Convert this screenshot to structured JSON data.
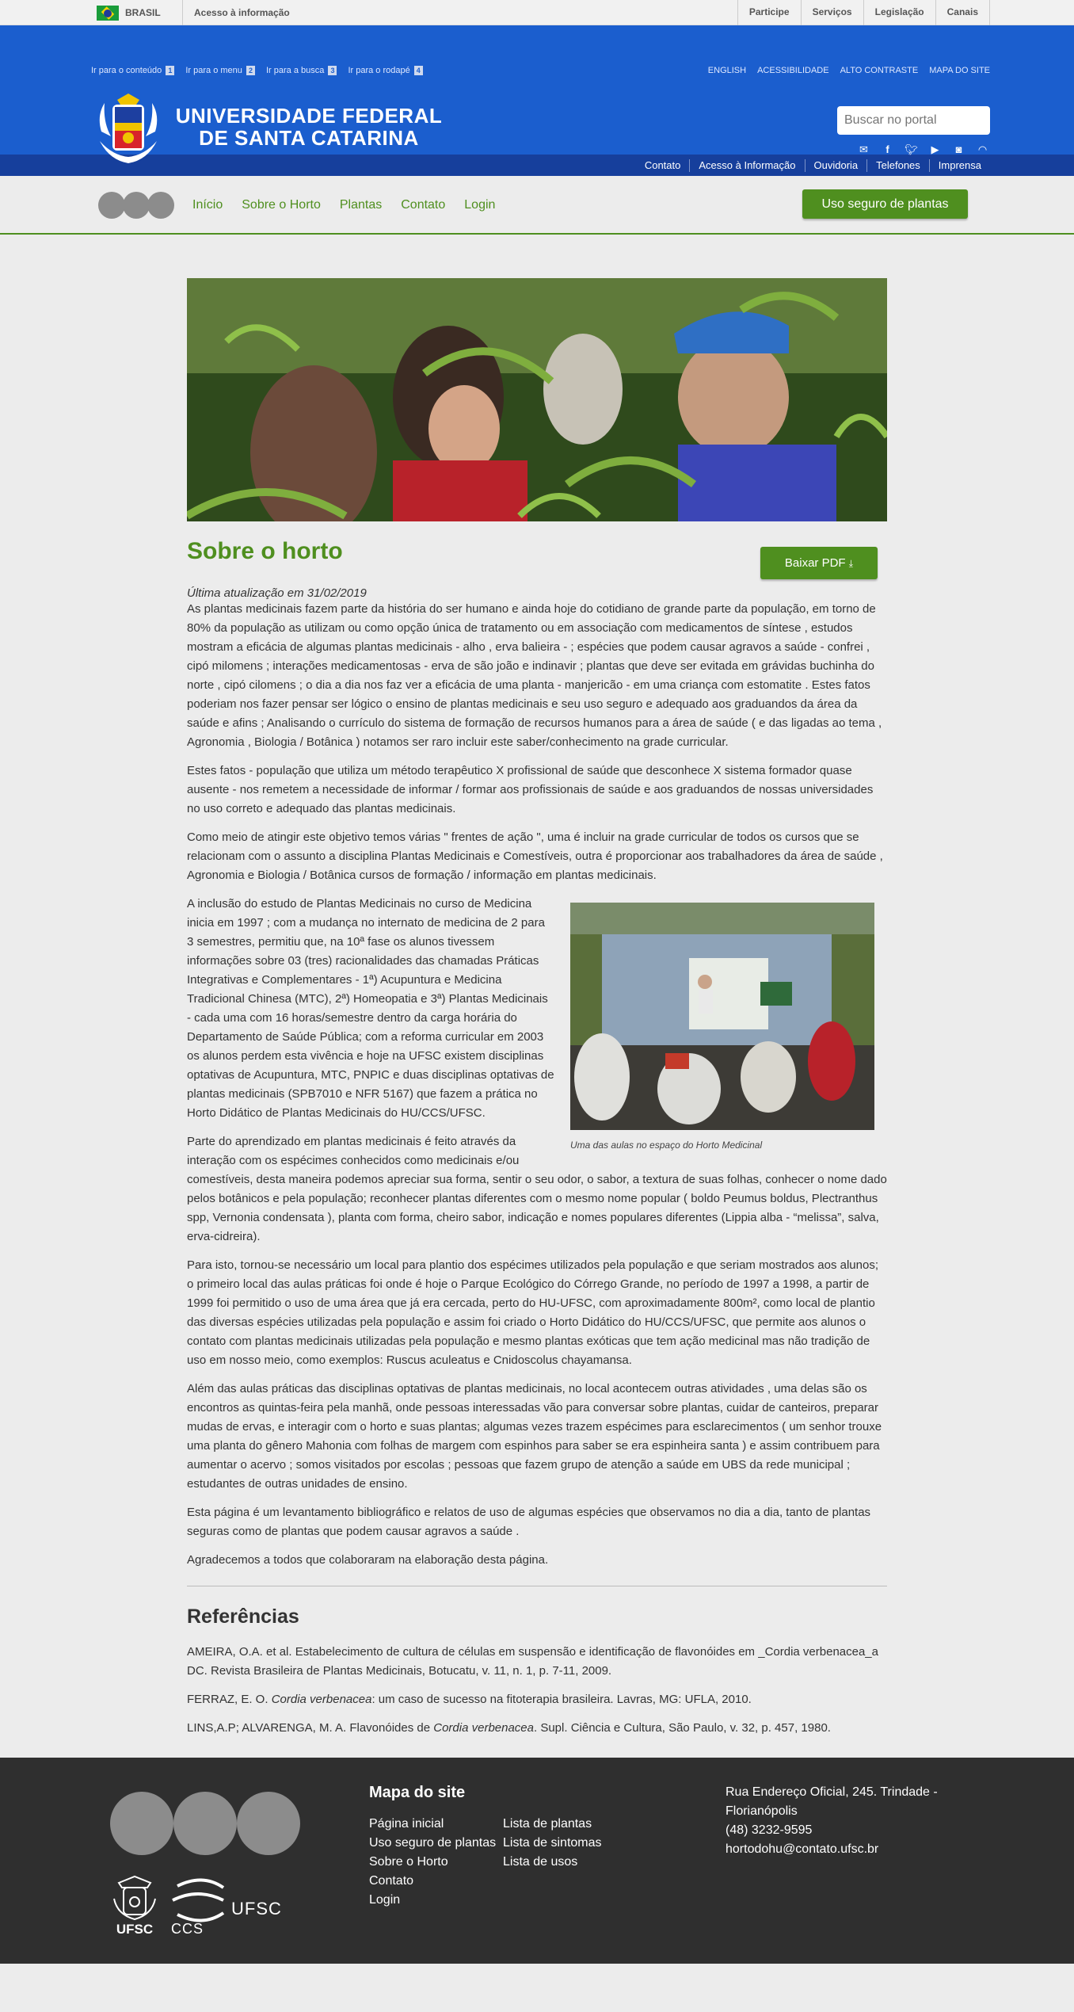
{
  "gov": {
    "country": "BRASIL",
    "access_info": "Acesso à informação",
    "links": [
      "Participe",
      "Serviços",
      "Legislação",
      "Canais"
    ]
  },
  "header": {
    "skip_links": [
      {
        "label": "Ir para o conteúdo",
        "num": "1"
      },
      {
        "label": "Ir para o menu",
        "num": "2"
      },
      {
        "label": "Ir para a busca",
        "num": "3"
      },
      {
        "label": "Ir para o rodapé",
        "num": "4"
      }
    ],
    "top_links": [
      "ENGLISH",
      "ACESSIBILIDADE",
      "ALTO CONTRASTE",
      "MAPA DO SITE"
    ],
    "university_line1": "UNIVERSIDADE FEDERAL",
    "university_line2": "DE SANTA CATARINA",
    "search_placeholder": "Buscar no portal",
    "social_icons": [
      "email-icon",
      "facebook-icon",
      "twitter-icon",
      "youtube-icon",
      "instagram-icon",
      "rss-icon"
    ],
    "sub_links": [
      "Contato",
      "Acesso à Informação",
      "Ouvidoria",
      "Telefones",
      "Imprensa"
    ]
  },
  "nav": {
    "links": [
      "Início",
      "Sobre o Horto",
      "Plantas",
      "Contato",
      "Login"
    ],
    "cta": "Uso seguro de plantas"
  },
  "page": {
    "title": "Sobre o horto",
    "pdf_button": "Baixar PDF",
    "updated": "Última atualização em 31/02/2019",
    "p1": "As plantas medicinais fazem parte da história do ser humano e ainda hoje do cotidiano de grande parte da população, em torno de 80% da população as utilizam ou como opção única de tratamento ou em associação com medicamentos de síntese , estudos mostram a eficácia de algumas plantas medicinais - alho , erva balieira - ; espécies que podem causar agravos a saúde - confrei , cipó milomens ; interações medicamentosas - erva de são joão e indinavir ; plantas que deve ser evitada em grávidas buchinha do norte , cipó cilomens ; o dia a dia nos faz ver a eficácia de uma planta - manjericão - em uma criança com estomatite . Estes fatos poderiam nos fazer pensar ser lógico o ensino de plantas medicinais e seu uso seguro e adequado aos graduandos da área da saúde e afins ; Analisando o currículo do sistema de formação de recursos humanos para a área de saúde ( e das ligadas ao tema , Agronomia , Biologia / Botânica ) notamos ser raro incluir este saber/conhecimento na grade curricular.",
    "p2": "Estes fatos - população que utiliza um método terapêutico X profissional de saúde que desconhece X sistema formador quase ausente - nos remetem a necessidade de informar / formar aos profissionais de saúde e aos graduandos de nossas universidades no uso correto e adequado das plantas medicinais.",
    "p3": "Como meio de atingir este objetivo temos várias \" frentes de ação \", uma é incluir na grade curricular de todos os cursos que se relacionam com o assunto a disciplina Plantas Medicinais e Comestíveis, outra é proporcionar aos trabalhadores da área de saúde , Agronomia e Biologia / Botânica cursos de formação / informação em plantas medicinais.",
    "p4": "A inclusão do estudo de Plantas Medicinais no curso de Medicina inicia em 1997 ; com a mudança no internato de medicina de 2 para 3 semestres, permitiu que, na 10ª fase os alunos tivessem informações sobre 03 (tres) racionalidades das chamadas Práticas Integrativas e Complementares - 1ª) Acupuntura e Medicina Tradicional Chinesa (MTC), 2ª) Homeopatia e 3ª) Plantas Medicinais - cada uma com 16 horas/semestre dentro da carga horária do Departamento de Saúde Pública; com a reforma curricular em 2003 os alunos perdem esta vivência e hoje na UFSC existem disciplinas optativas de Acupuntura, MTC, PNPIC e duas disciplinas optativas de plantas medicinais (SPB7010 e NFR 5167) que fazem a prática no Horto Didático de Plantas Medicinais do HU/CCS/UFSC.",
    "figure_caption": "Uma das aulas no espaço do Horto Medicinal",
    "p5": "Parte do aprendizado em plantas medicinais é feito através da interação com os espécimes conhecidos como medicinais e/ou comestíveis, desta maneira podemos apreciar sua forma, sentir o seu odor, o sabor, a textura de suas folhas, conhecer o nome dado pelos botânicos e pela população; reconhecer plantas diferentes com o mesmo nome popular ( boldo Peumus boldus, Plectranthus spp, Vernonia condensata ), planta com forma, cheiro sabor, indicação e nomes populares diferentes (Lippia alba - “melissa”, salva, erva-cidreira).",
    "p6": "Para isto, tornou-se necessário um local para plantio dos espécimes utilizados pela população e que seriam mostrados aos alunos; o primeiro local das aulas práticas foi onde é hoje o Parque Ecológico do Córrego Grande, no período de 1997 a 1998, a partir de 1999 foi permitido o uso de uma área que já era cercada, perto do HU-UFSC, com aproximadamente 800m², como local de plantio das diversas espécies utilizadas pela população e assim foi criado o Horto Didático do HU/CCS/UFSC, que permite aos alunos o contato com plantas medicinais utilizadas pela população e mesmo plantas exóticas que tem ação medicinal mas não tradição de uso em nosso meio, como exemplos: Ruscus aculeatus e Cnidoscolus chayamansa.",
    "p7": "Além das aulas práticas das disciplinas optativas de plantas medicinais, no local acontecem outras atividades , uma delas são os encontros as quintas-feira pela manhã, onde pessoas interessadas vão para conversar sobre plantas, cuidar de canteiros, preparar mudas de ervas, e interagir com o horto e suas plantas; algumas vezes trazem espécimes para esclarecimentos ( um senhor trouxe uma planta do gênero Mahonia com folhas de margem com espinhos para saber se era espinheira santa ) e assim contribuem para aumentar o acervo ; somos visitados por escolas ; pessoas que fazem grupo de atenção a saúde em UBS da rede municipal ; estudantes de outras unidades de ensino.",
    "p8": "Esta página é um levantamento bibliográfico e relatos de uso de algumas espécies que observamos no dia a dia, tanto de plantas seguras como de plantas que podem causar agravos a saúde .",
    "p9": "Agradecemos a todos que colaboraram na elaboração desta página.",
    "refs_title": "Referências",
    "ref1": "AMEIRA, O.A. et al. Estabelecimento de cultura de células em suspensão e identificação de flavonóides em _Cordia verbenacea_a DC. Revista Brasileira de Plantas Medicinais, Botucatu, v. 11, n. 1, p. 7-11, 2009.",
    "ref2_a": "FERRAZ, E. O. ",
    "ref2_em": "Cordia verbenacea",
    "ref2_b": ": um caso de sucesso na fitoterapia brasileira. Lavras, MG: UFLA, 2010.",
    "ref3_a": "LINS,A.P; ALVARENGA, M. A. Flavonóides de ",
    "ref3_em": "Cordia verbenacea",
    "ref3_b": ". Supl. Ciência e Cultura, São Paulo, v. 32, p. 457, 1980."
  },
  "footer": {
    "map_title": "Mapa do site",
    "col1": [
      "Página inicial",
      "Uso seguro de plantas",
      "Sobre o Horto",
      "Contato",
      "Login"
    ],
    "col2": [
      "Lista de plantas",
      "Lista de sintomas",
      "Lista de usos"
    ],
    "address": "Rua Endereço Oficial, 245. Trindade - Florianópolis",
    "phone": "(48) 3232-9595",
    "email": "hortodohu@contato.ufsc.br",
    "logo_ufsc": "UFSC",
    "logo_ccs": "CCS",
    "logo_ufsc2": "UFSC"
  },
  "colors": {
    "header_blue": "#1b5ece",
    "dark_blue": "#163f9c",
    "green": "#4f8f1f",
    "footer": "#2f2f2f"
  }
}
